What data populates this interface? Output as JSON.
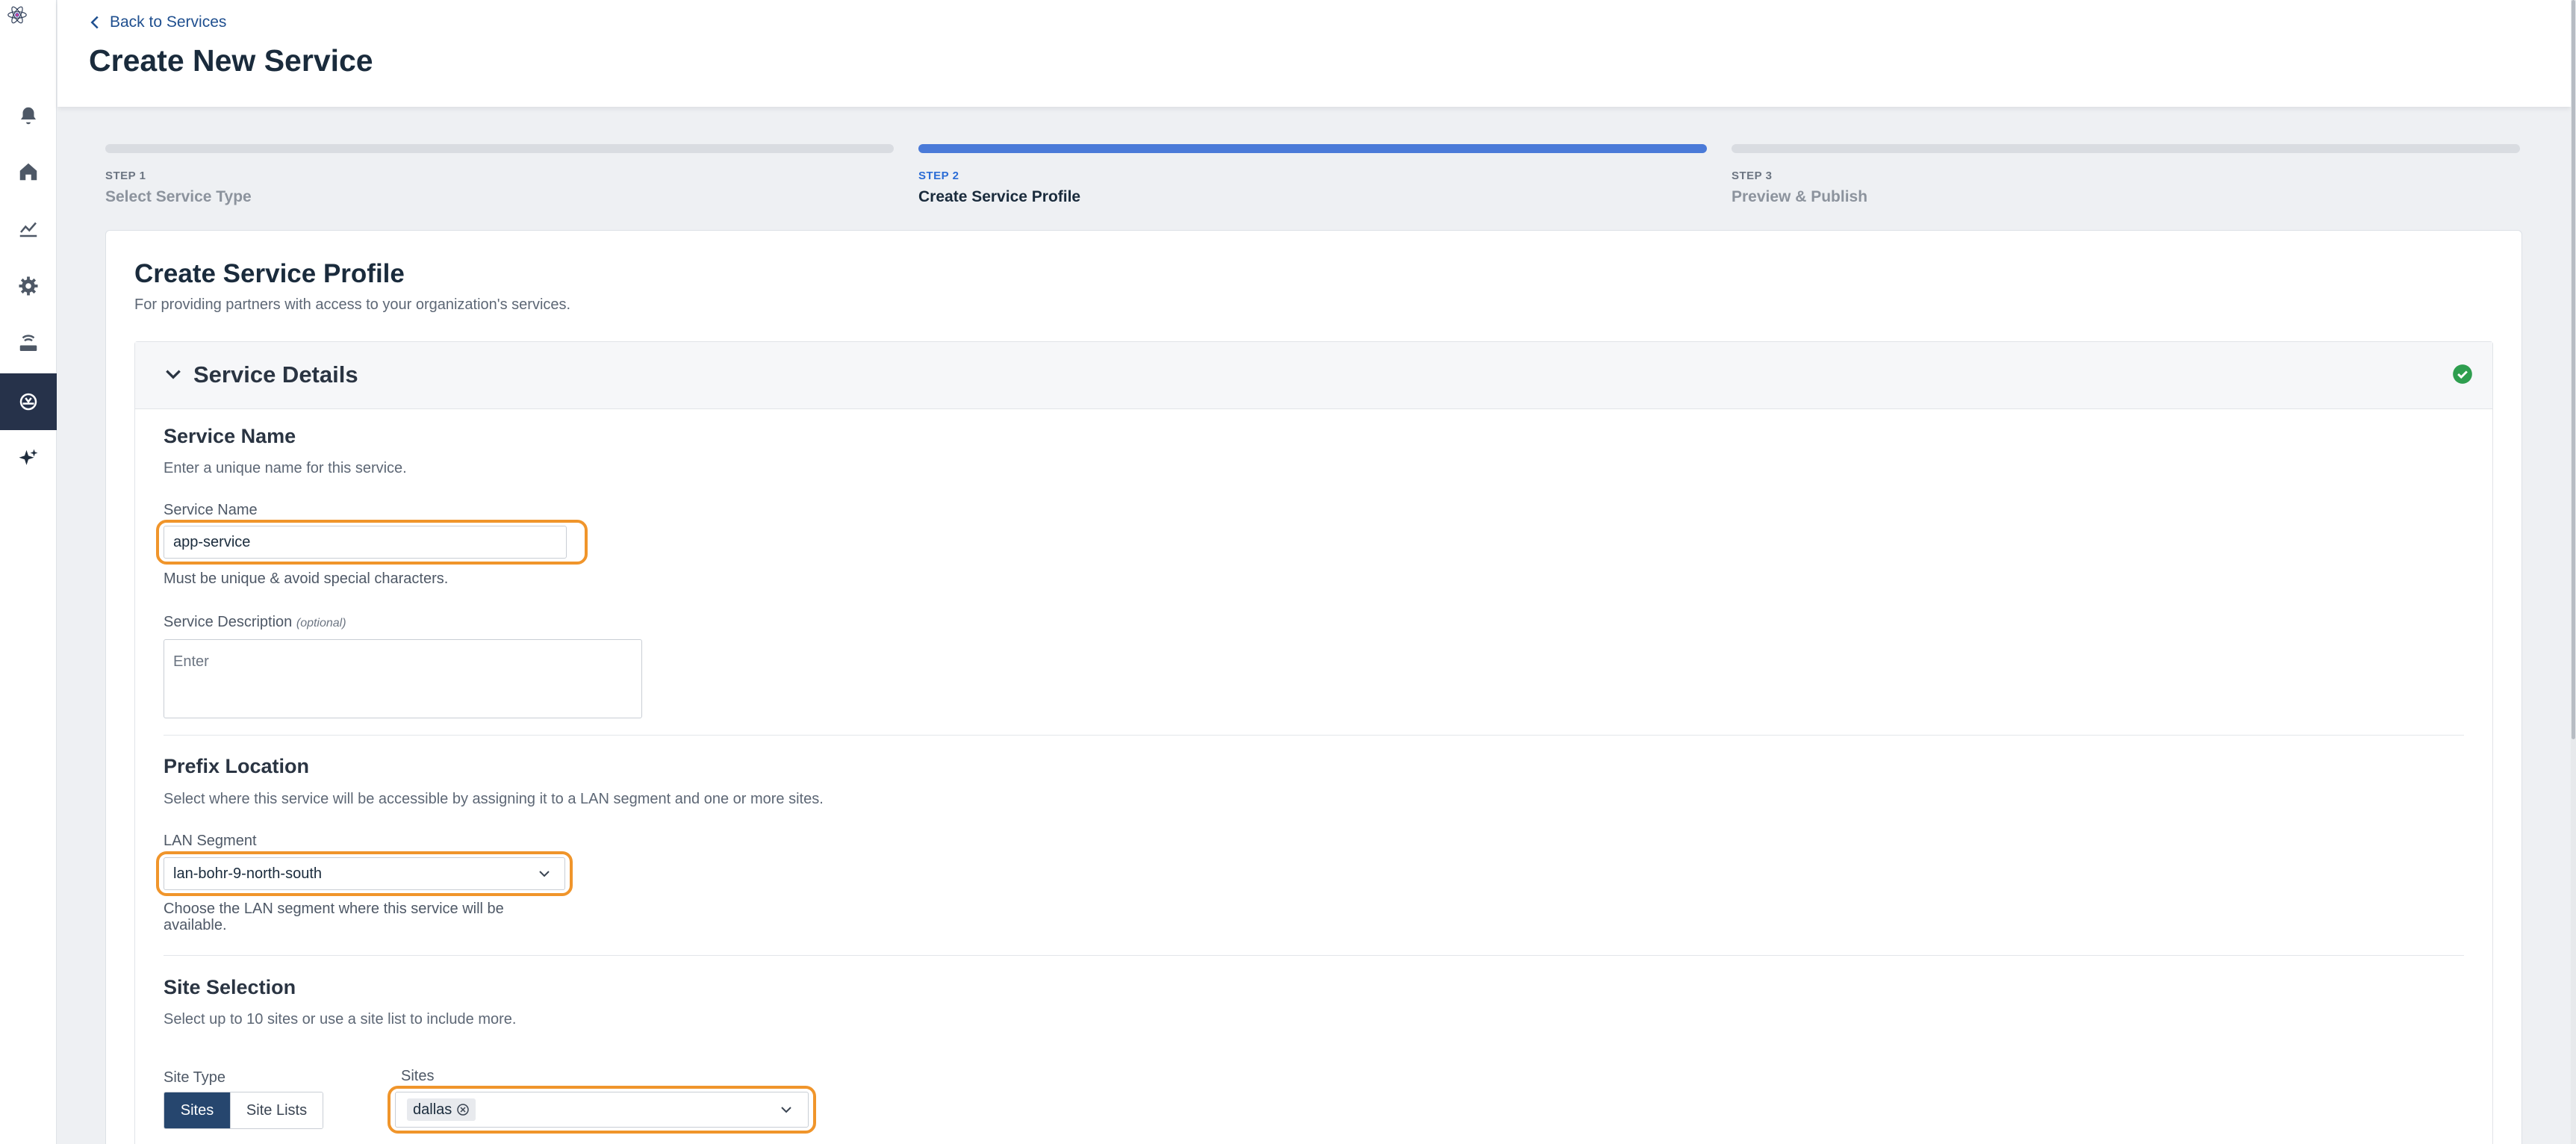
{
  "header": {
    "back_label": "Back to Services",
    "title": "Create New Service"
  },
  "sidebar": {
    "icons": [
      "atom-logo-icon",
      "bell-icon",
      "home-icon",
      "chart-line-icon",
      "gear-icon",
      "router-icon",
      "services-icon",
      "sparkles-icon"
    ],
    "active_item": "services-icon"
  },
  "steps": [
    {
      "number": "STEP 1",
      "label": "Select Service Type",
      "state": "inactive"
    },
    {
      "number": "STEP 2",
      "label": "Create Service Profile",
      "state": "active"
    },
    {
      "number": "STEP 3",
      "label": "Preview & Publish",
      "state": "inactive"
    }
  ],
  "card": {
    "title": "Create Service Profile",
    "subtitle": "For providing partners with access to your organization's services."
  },
  "panel": {
    "title": "Service Details",
    "status_icon": "check-circle-icon",
    "status_color": "#2e9e4f"
  },
  "service_name": {
    "section_title": "Service Name",
    "section_sub": "Enter a unique name for this service.",
    "label": "Service Name",
    "value": "app-service",
    "help": "Must be unique & avoid special characters."
  },
  "service_description": {
    "label": "Service Description",
    "optional": "(optional)",
    "placeholder": "Enter"
  },
  "prefix_location": {
    "section_title": "Prefix Location",
    "section_sub": "Select where this service will be accessible by assigning it to a LAN segment and one or more sites.",
    "lan_label": "LAN Segment",
    "lan_value": "lan-bohr-9-north-south",
    "lan_help": "Choose the LAN segment where this service will be available."
  },
  "site_selection": {
    "section_title": "Site Selection",
    "section_sub": "Select up to 10 sites or use a site list to include more.",
    "site_type_label": "Site Type",
    "site_type_options": [
      "Sites",
      "Site Lists"
    ],
    "site_type_selected": "Sites",
    "sites_label": "Sites",
    "sites_selected": [
      "dallas"
    ]
  },
  "colors": {
    "highlight": "#f0952b",
    "accent": "#4a7ad8",
    "rail_active": "#26324a"
  }
}
